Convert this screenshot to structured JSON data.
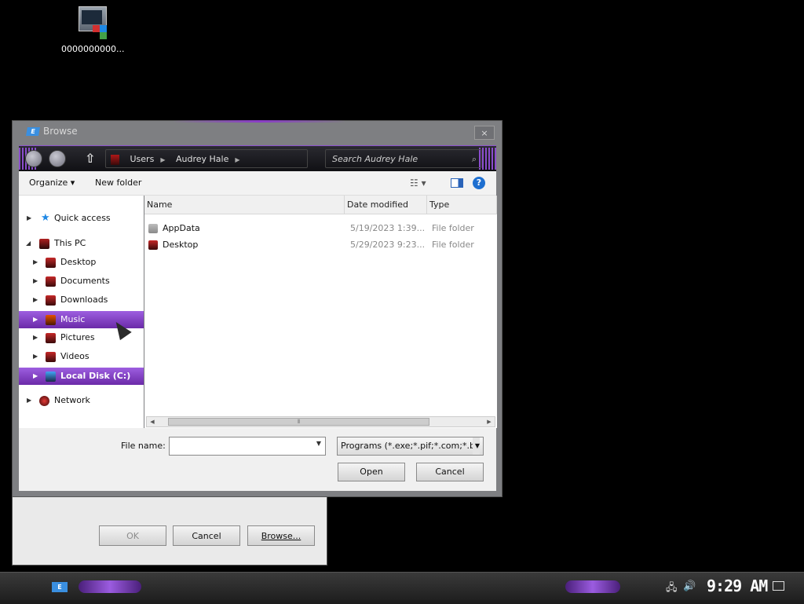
{
  "desktop": {
    "icon_label": "0000000000..."
  },
  "background_dialog": {
    "ok_label": "OK",
    "cancel_label": "Cancel",
    "browse_label": "Browse..."
  },
  "browse": {
    "title": "Browse",
    "close_glyph": "×",
    "breadcrumb": [
      "Users",
      "Audrey Hale"
    ],
    "search_placeholder": "Search Audrey Hale",
    "toolbar": {
      "organize_label": "Organize",
      "new_folder_label": "New folder"
    },
    "nav": [
      {
        "label": "Quick access"
      },
      {
        "label": "This PC"
      },
      {
        "label": "Desktop"
      },
      {
        "label": "Documents"
      },
      {
        "label": "Downloads"
      },
      {
        "label": "Music"
      },
      {
        "label": "Pictures"
      },
      {
        "label": "Videos"
      },
      {
        "label": "Local Disk (C:)"
      },
      {
        "label": "Network"
      }
    ],
    "columns": {
      "name": "Name",
      "date": "Date modified",
      "type": "Type"
    },
    "files": [
      {
        "name": "AppData",
        "date": "5/19/2023 1:39...",
        "type": "File folder"
      },
      {
        "name": "Desktop",
        "date": "5/29/2023 9:23...",
        "type": "File folder"
      }
    ],
    "file_name_label": "File name:",
    "file_name_value": "",
    "filter_value": "Programs (*.exe;*.pif;*.com;*.ba",
    "open_label": "Open",
    "cancel_label": "Cancel"
  },
  "taskbar": {
    "clock": "9:29 AM"
  },
  "colors": {
    "accent": "#8a4ccc",
    "selection": "#7b3bbf"
  }
}
